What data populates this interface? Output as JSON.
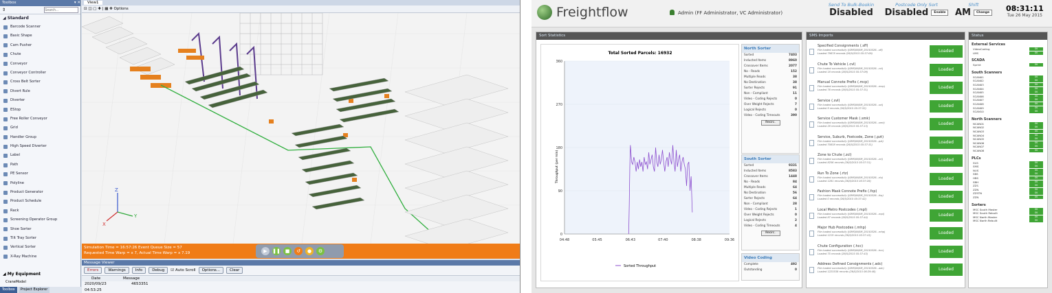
{
  "toolbox": {
    "title": "Toolbox",
    "search": "Search...",
    "section": "Standard",
    "items": [
      "Barcode Scanner",
      "Basic Shape",
      "Cam Pusher",
      "Chute",
      "Conveyor",
      "Conveyor Controller",
      "Cross Belt Sorter",
      "Divert Rule",
      "Diverter",
      "EStop",
      "Free Roller Conveyor",
      "Grid",
      "Handler Group",
      "High Speed Diverter",
      "Label",
      "Path",
      "PE Sensor",
      "Polyline",
      "Product Generator",
      "Product Schedule",
      "Rack",
      "Screening Operator Group",
      "Shoe Sorter",
      "Tilt Tray Sorter",
      "Vertical Sorter",
      "X-Ray Machine"
    ],
    "my_equipment": "My Equipment",
    "my_item": "CraneModel",
    "tab1": "Toolbox",
    "tab2": "Project Explorer"
  },
  "view": {
    "tab": "View1",
    "options": "Options",
    "status1": "Simulation Time = 16:57:26  Event Queue Size = 57",
    "status2": "Requested Time Warp = x 7, Actual Time Warp = x 7.19",
    "axis_x": "X",
    "axis_y": "Y",
    "axis_z": "Z"
  },
  "messages": {
    "title": "Message Viewer",
    "errors": "Errors",
    "warnings": "Warnings",
    "info": "Info",
    "debug": "Debug",
    "autoscroll": "Auto Scroll",
    "options": "Options...",
    "clear": "Clear",
    "col_date": "Date",
    "col_msg": "Message",
    "row_date": "2020/09/23 04:53:25",
    "row_msg": "4653351"
  },
  "dash": {
    "brand": "Freightflow",
    "admin": "Admin (FF Administrator, VC Administrator)",
    "bulk_label": "Send To Bulk-Bookin",
    "bulk_value": "Disabled",
    "pc_label": "Postcode Only Sort",
    "pc_value": "Disabled",
    "pc_btn": "Enable",
    "shift_label": "Shift",
    "shift_value": "AM",
    "shift_btn": "Change",
    "time": "08:31:11",
    "date": "Tue 26 May 2015"
  },
  "sort_stats": {
    "title": "Sort Statistics",
    "chart_title": "Total Sorted Parcels: 16932",
    "legend": "Sorted Throughput",
    "ylabel": "Throughput (per min)"
  },
  "chart_data": {
    "type": "line",
    "title": "Total Sorted Parcels: 16932",
    "xlabel": "",
    "ylabel": "Throughput (per min)",
    "x_ticks": [
      "04:48",
      "05:45",
      "06:43",
      "07:40",
      "08:38",
      "09:36"
    ],
    "y_ticks": [
      0,
      90,
      180,
      270,
      360
    ],
    "ylim": [
      0,
      360
    ],
    "series": [
      {
        "name": "Sorted Throughput",
        "color": "#8c4fcf",
        "x": [
          "06:40",
          "06:41",
          "06:42",
          "06:43",
          "06:44",
          "06:45",
          "06:47",
          "06:49",
          "06:51",
          "06:53",
          "06:55",
          "06:57",
          "06:59",
          "07:01",
          "07:03",
          "07:05",
          "07:07",
          "07:09",
          "07:11",
          "07:13",
          "07:15",
          "07:17",
          "07:19",
          "07:21",
          "07:23",
          "07:25",
          "07:27",
          "07:29",
          "07:31",
          "07:33",
          "07:35",
          "07:37",
          "07:39",
          "07:41",
          "07:43",
          "07:45",
          "07:47",
          "07:49",
          "07:51",
          "07:53",
          "07:55",
          "07:57",
          "07:59",
          "08:01",
          "08:03",
          "08:05",
          "08:07",
          "08:09",
          "08:11",
          "08:13",
          "08:15",
          "08:17",
          "08:19",
          "08:21",
          "08:23",
          "08:25",
          "08:27",
          "08:29",
          "08:31"
        ],
        "values": [
          0,
          60,
          140,
          185,
          170,
          150,
          145,
          160,
          150,
          130,
          150,
          135,
          155,
          140,
          150,
          130,
          160,
          145,
          150,
          135,
          170,
          145,
          155,
          165,
          140,
          130,
          180,
          150,
          140,
          165,
          145,
          155,
          175,
          150,
          130,
          150,
          160,
          140,
          170,
          155,
          145,
          185,
          150,
          130,
          175,
          140,
          155,
          165,
          130,
          150,
          160,
          145,
          135,
          100,
          145,
          150,
          90,
          120,
          45
        ]
      }
    ]
  },
  "north": {
    "title": "North Sorter",
    "rows": [
      [
        "Sorted",
        "7403"
      ],
      [
        "Inducted Items",
        "8960"
      ],
      [
        "Crossover Items",
        "2077"
      ],
      [
        "No - Reads",
        "152"
      ],
      [
        "Multiple Reads",
        "38"
      ],
      [
        "No Destination",
        "38"
      ],
      [
        "Sorter Rejects",
        "91"
      ],
      [
        "Non - Compliant",
        "11"
      ],
      [
        "Video - Coding Rejects",
        "0"
      ],
      [
        "Over Weight Rejects",
        "7"
      ],
      [
        "Logical Rejects",
        "0"
      ],
      [
        "Video - Coding Timeouts",
        "390"
      ]
    ],
    "btn": "Recirc."
  },
  "south": {
    "title": "South Sorter",
    "rows": [
      [
        "Sorted",
        "9331"
      ],
      [
        "Inducted Items",
        "8583"
      ],
      [
        "Crossover Items",
        "1448"
      ],
      [
        "No - Reads",
        "84"
      ],
      [
        "Multiple Reads",
        "64"
      ],
      [
        "No Destination",
        "56"
      ],
      [
        "Sorter Rejects",
        "64"
      ],
      [
        "Non - Compliant",
        "28"
      ],
      [
        "Video - Coding Rejects",
        "1"
      ],
      [
        "Over Weight Rejects",
        "0"
      ],
      [
        "Logical Rejects",
        "2"
      ],
      [
        "Video - Coding Timeouts",
        "4"
      ]
    ],
    "btn": "Recirc."
  },
  "video": {
    "title": "Video Coding",
    "rows": [
      [
        "Complete",
        "492"
      ],
      [
        "Outstanding",
        "0"
      ]
    ]
  },
  "sms": {
    "title": "SMS Imports",
    "status": "Loaded",
    "items": [
      {
        "name": "Specified Consignments (.sff)",
        "d1": "File loaded successfully (\\SMS\\IN\\SM_20150526...sff)",
        "d2": "Loaded 79878 records (26/5/2015 05:37:09)"
      },
      {
        "name": "Chute To Vehicle (.cvl)",
        "d1": "File loaded successfully (\\SMS\\IN\\SM_20150526...cvl)",
        "d2": "Loaded 18 records (26/5/2015 05:37:09)"
      },
      {
        "name": "Manual Connote Prefix (.mcp)",
        "d1": "File loaded successfully (\\SMS\\IN\\SM_20150526...mcp)",
        "d2": "Loaded 76 records (26/5/2015 05:37:31)"
      },
      {
        "name": "Service (.svl)",
        "d1": "File loaded successfully (\\SMS\\IN\\SM_20150526...svl)",
        "d2": "Loaded 9 records (26/5/2015 05:37:32)"
      },
      {
        "name": "Service Customer Mask (.smk)",
        "d1": "File loaded successfully (\\SMS\\IN\\SM_20150526...smk)",
        "d2": "Loaded 28 records (26/5/2015 05:37:13)"
      },
      {
        "name": "Service, Suburb, Postcode, Zone (.pzt)",
        "d1": "File loaded successfully (\\SMS\\IN\\SM_20150526...pzt)",
        "d2": "Loaded 70838 records (26/5/2015 05:37:31)"
      },
      {
        "name": "Zone to Chute (.zcl)",
        "d1": "File loaded successfully (\\SMS\\IN\\SM_20150526...zcl)",
        "d2": "Loaded 8256 records (26/5/2015 05:37:31)"
      },
      {
        "name": "Run To Zone (.rtz)",
        "d1": "File loaded successfully (\\SMS\\IN\\SM_20150526...rtz)",
        "d2": "Loaded 1281 records (26/5/2015 05:37:28)"
      },
      {
        "name": "Fashion Mask Connote Prefix (.fcp)",
        "d1": "File loaded successfully (\\SMS\\IN\\SM_20150526...fcp)",
        "d2": "Loaded 0 records (26/5/2015 05:37:42)"
      },
      {
        "name": "Local Metro Postcodes (.mpl)",
        "d1": "File loaded successfully (\\SMS\\IN\\SM_20150526...mpl)",
        "d2": "Loaded 87 records (26/5/2015 05:37:44)"
      },
      {
        "name": "Major Hub Postcodes (.mhp)",
        "d1": "File loaded successfully (\\SMS\\IN\\SM_20150526...mhp)",
        "d2": "Loaded 1219 records (26/5/2015 05:37:43)"
      },
      {
        "name": "Chute Configuration (.hcc)",
        "d1": "File loaded successfully (\\SMS\\IN\\SM_20150526...hcc)",
        "d2": "Loaded 75 records (26/5/2015 05:37:43)"
      },
      {
        "name": "Address Defined Consignments (.adc)",
        "d1": "File loaded successfully (\\SMS\\IN\\SM_20150526...adc)",
        "d2": "Loaded 1223538 records (26/5/2015 06:29:48)"
      }
    ]
  },
  "status_panel": {
    "title": "Status",
    "ok": "OK",
    "groups": [
      {
        "name": "External Services",
        "items": [
          "VideoCoding",
          "LMS"
        ]
      },
      {
        "name": "SCADA",
        "items": [
          "Sprint"
        ]
      },
      {
        "name": "South Scanners",
        "items": [
          "SCAN01",
          "SCAN02",
          "SCAN03",
          "SCAN04",
          "SCAN05",
          "SCAN06",
          "SCAN07",
          "SCAN08",
          "SCAN09",
          "SCAN10"
        ]
      },
      {
        "name": "North Scanners",
        "items": [
          "NCAN01",
          "NCAN02",
          "NCAN03",
          "NCAN04",
          "NCAN05",
          "NCAN06",
          "NCAN07",
          "NCAN08"
        ]
      },
      {
        "name": "PLCs",
        "items": [
          "SUS",
          "SMS",
          "NUS",
          "SBS",
          "HBS",
          "SBH",
          "ZZS",
          "ZZN",
          "ZZSTN",
          "ZZN"
        ]
      },
      {
        "name": "Sorters",
        "items": [
          "MSC South Master",
          "MSC South Rebuilt",
          "MSC North Master",
          "MSC North Rebuilt"
        ]
      }
    ]
  }
}
